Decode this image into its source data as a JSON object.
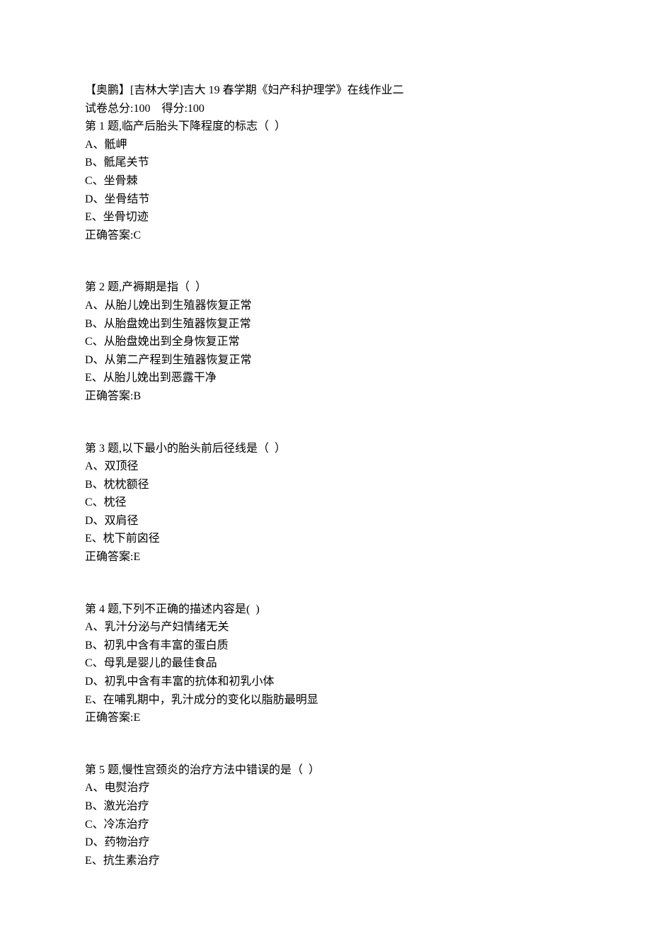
{
  "header": {
    "title": "【奥鹏】[吉林大学]吉大 19 春学期《妇产科护理学》在线作业二",
    "score_line": "试卷总分:100    得分:100"
  },
  "questions": [
    {
      "stem": "第 1 题,临产后胎头下降程度的标志（  ）",
      "options": [
        "A、骶岬",
        "B、骶尾关节",
        "C、坐骨棘",
        "D、坐骨结节",
        "E、坐骨切迹"
      ],
      "answer": "正确答案:C"
    },
    {
      "stem": "第 2 题,产褥期是指（  ）",
      "options": [
        "A、从胎儿娩出到生殖器恢复正常",
        "B、从胎盘娩出到生殖器恢复正常",
        "C、从胎盘娩出到全身恢复正常",
        "D、从第二产程到生殖器恢复正常",
        "E、从胎儿娩出到恶露干净"
      ],
      "answer": "正确答案:B"
    },
    {
      "stem": "第 3 题,以下最小的胎头前后径线是（  ）",
      "options": [
        "A、双顶径",
        "B、枕枕额径",
        "C、枕径",
        "D、双肩径",
        "E、枕下前囟径"
      ],
      "answer": "正确答案:E"
    },
    {
      "stem": "第 4 题,下列不正确的描述内容是(  )",
      "options": [
        "A、乳汁分泌与产妇情绪无关",
        "B、初乳中含有丰富的蛋白质",
        "C、母乳是婴儿的最佳食品",
        "D、初乳中含有丰富的抗体和初乳小体",
        "E、在哺乳期中，乳汁成分的变化以脂肪最明显"
      ],
      "answer": "正确答案:E"
    },
    {
      "stem": "第 5 题,慢性宫颈炎的治疗方法中错误的是（  ）",
      "options": [
        "A、电熨治疗",
        "B、激光治疗",
        "C、冷冻治疗",
        "D、药物治疗",
        "E、抗生素治疗"
      ],
      "answer": ""
    }
  ]
}
